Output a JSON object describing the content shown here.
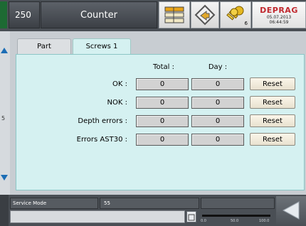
{
  "header": {
    "station": "250",
    "title": "Counter",
    "user_level": "6",
    "brand": "DEPRAG",
    "date": "05.07.2013",
    "time": "06:44:59"
  },
  "side": {
    "marker": "5"
  },
  "tabs": [
    {
      "label": "Part",
      "active": false
    },
    {
      "label": "Screws 1",
      "active": true
    }
  ],
  "table": {
    "col_total": "Total :",
    "col_day": "Day :",
    "rows": [
      {
        "label": "OK :",
        "total": "0",
        "day": "0",
        "reset": "Reset"
      },
      {
        "label": "NOK :",
        "total": "0",
        "day": "0",
        "reset": "Reset"
      },
      {
        "label": "Depth errors :",
        "total": "0",
        "day": "0",
        "reset": "Reset"
      },
      {
        "label": "Errors AST30 :",
        "total": "0",
        "day": "0",
        "reset": "Reset"
      }
    ]
  },
  "footer": {
    "mode": "Service Mode",
    "mode_value": "55",
    "scale": [
      "0.0",
      "50.0",
      "100.0"
    ],
    "progress": 0
  },
  "colors": {
    "panel_bg": "#d5f1f1",
    "brand_red": "#c0282e"
  }
}
